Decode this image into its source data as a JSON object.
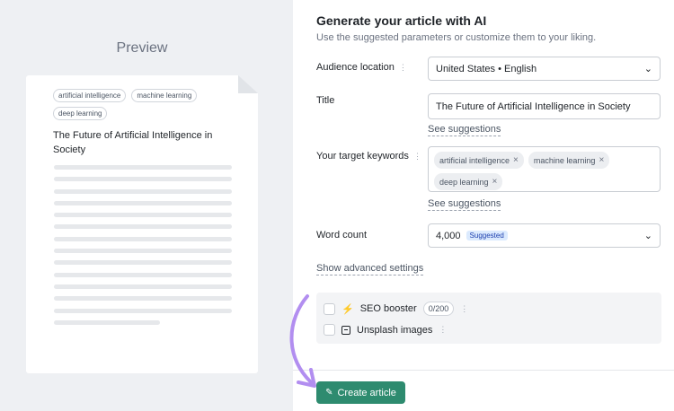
{
  "preview": {
    "heading": "Preview",
    "tags": [
      "artificial intelligence",
      "machine learning",
      "deep learning"
    ],
    "title": "The Future of Artificial Intelligence in Society"
  },
  "form": {
    "title": "Generate your article with AI",
    "subtitle": "Use the suggested parameters or customize them to your liking.",
    "audience_label": "Audience location",
    "audience_value": "United States • English",
    "title_label": "Title",
    "title_value": "The Future of Artificial Intelligence in Society",
    "see_suggestions": "See suggestions",
    "keywords_label": "Your target keywords",
    "keywords": [
      "artificial intelligence",
      "machine learning",
      "deep learning"
    ],
    "word_count_label": "Word count",
    "word_count_value": "4,000",
    "word_count_badge": "Suggested",
    "advanced_link": "Show advanced settings",
    "seo_booster_label": "SEO booster",
    "seo_booster_counter": "0/200",
    "unsplash_label": "Unsplash images",
    "create_button": "Create article"
  },
  "colors": {
    "accent_button": "#2e8b6f",
    "arrow": "#b28ef0",
    "bolt": "#7c3aed"
  },
  "icons": {
    "info": "info-icon",
    "chevron": "chevron-down-icon",
    "remove": "close-icon",
    "bolt": "lightning-icon",
    "images": "image-icon",
    "pen": "pen-icon"
  }
}
